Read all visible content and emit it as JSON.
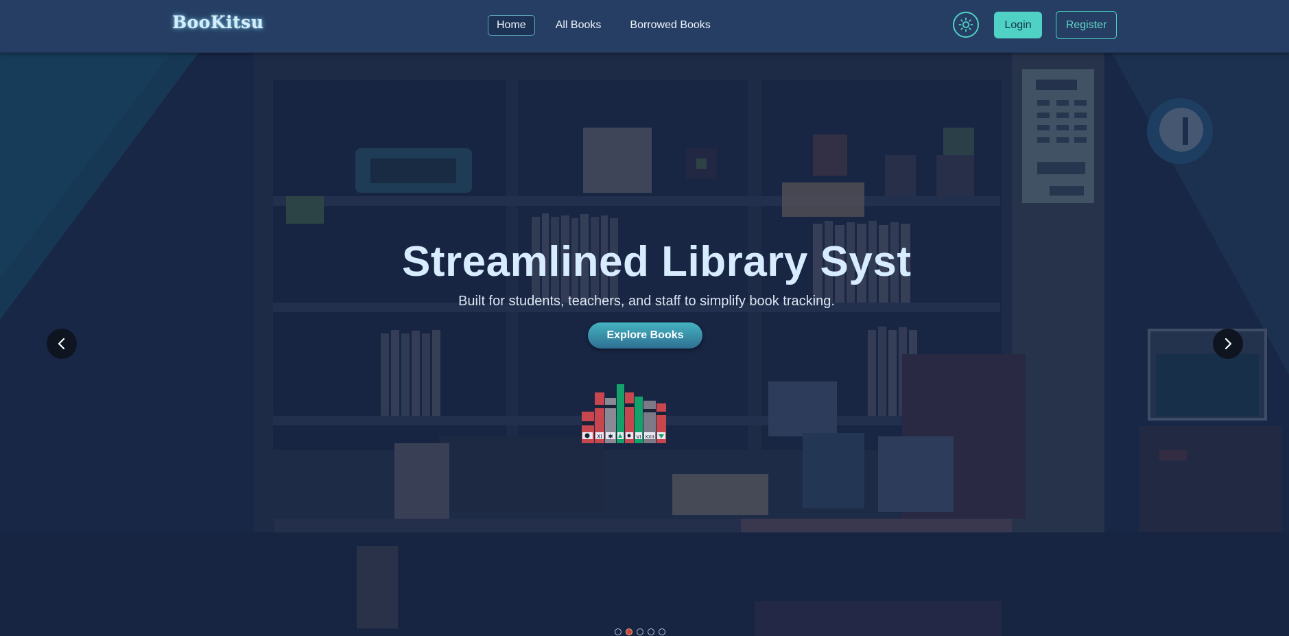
{
  "brand": "BooKitsu",
  "nav": {
    "links": [
      "Home",
      "All Books",
      "Borrowed Books"
    ],
    "active": "Home"
  },
  "auth": {
    "login_label": "Login",
    "register_label": "Register"
  },
  "hero": {
    "title": "Streamlined Library Syst",
    "subtitle": "Built for students, teachers, and staff to simplify book tracking.",
    "cta_label": "Explore Books",
    "icons": {
      "theme_toggle": "sun-icon",
      "prev": "chevron-left-icon",
      "next": "chevron-right-icon",
      "books": "books-stack-icon"
    },
    "book_spine_labels": [
      "XI",
      "VI",
      "XXII"
    ]
  },
  "carousel": {
    "slide_count": 5,
    "active_index": 1
  },
  "colors": {
    "navbar": "#263e63",
    "accent": "#4fd1c5",
    "title": "#d7ecff",
    "hero_bg": "#1f2d4c"
  }
}
